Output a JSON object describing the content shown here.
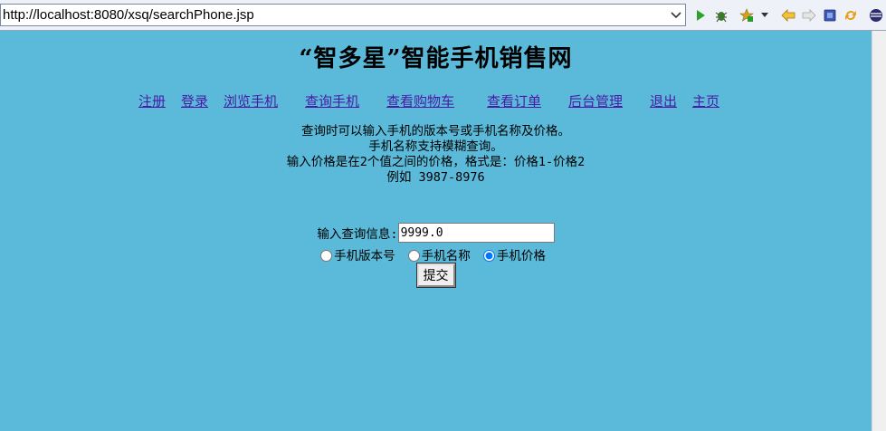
{
  "browser": {
    "url": "http://localhost:8080/xsq/searchPhone.jsp",
    "toolbar_icons": [
      "run-icon",
      "debug-icon",
      "external-tools-icon",
      "dropdown-icon",
      "back-icon",
      "forward-icon",
      "stop-icon",
      "refresh-icon",
      "eclipse-icon"
    ]
  },
  "page": {
    "title": "“智多星”智能手机销售网",
    "nav": [
      "注册",
      "登录",
      "浏览手机",
      "查询手机",
      "查看购物车",
      "查看订单",
      "后台管理",
      "退出",
      "主页"
    ],
    "info_lines": [
      "查询时可以输入手机的版本号或手机名称及价格。",
      "手机名称支持模糊查询。",
      "输入价格是在2个值之间的价格，格式是：价格1-价格2",
      "例如 3987-8976"
    ],
    "query_label": "输入查询信息:",
    "query_value": "9999.0",
    "radios": [
      {
        "label": "手机版本号",
        "checked": false
      },
      {
        "label": "手机名称",
        "checked": false
      },
      {
        "label": "手机价格",
        "checked": true
      }
    ],
    "submit_label": "提交"
  },
  "colors": {
    "page_background": "#5bbad9",
    "link": "#4a1aa6"
  }
}
